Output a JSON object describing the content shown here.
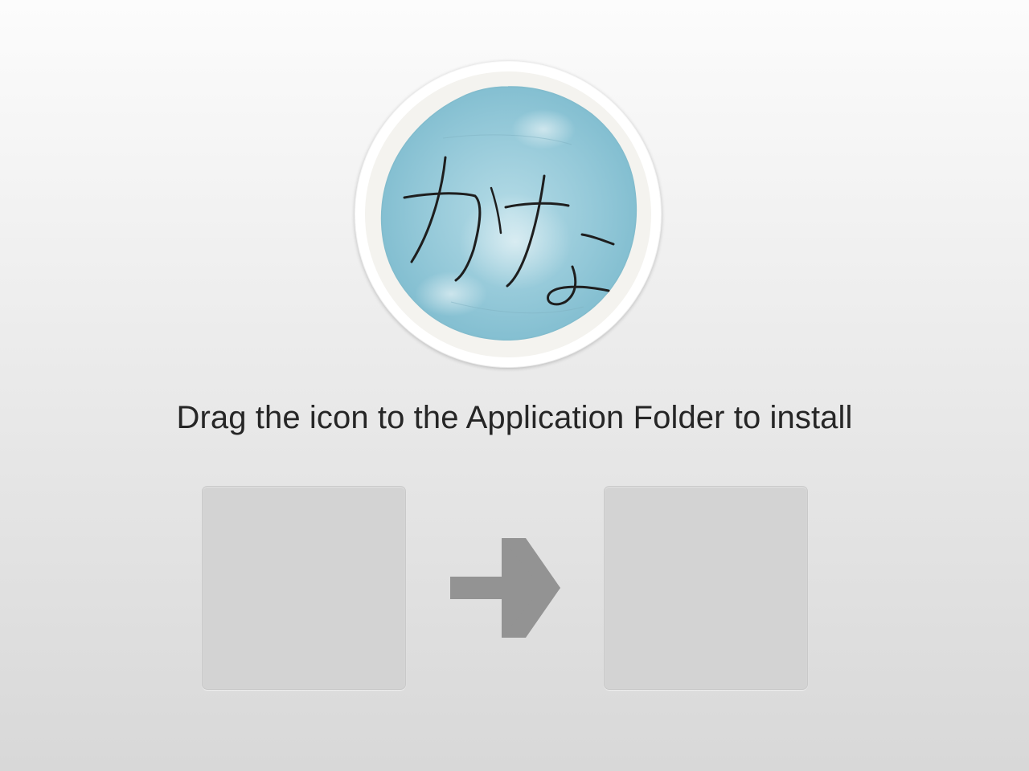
{
  "installer": {
    "instruction": "Drag the icon to the Application Folder to install",
    "logo": {
      "icon": "kana-watercolor-logo",
      "text": "かな",
      "colors": {
        "ring": "#f5f4f0",
        "wash": "#8ec6d6",
        "ink": "#1e1e1e"
      }
    },
    "app_slot": {
      "icon": "app-drop-slot"
    },
    "arrow": {
      "icon": "arrow-right-icon",
      "color": "#939393"
    },
    "folder_slot": {
      "icon": "applications-folder-slot"
    },
    "colors": {
      "slot_fill": "#d3d3d3",
      "text": "#262626"
    }
  }
}
